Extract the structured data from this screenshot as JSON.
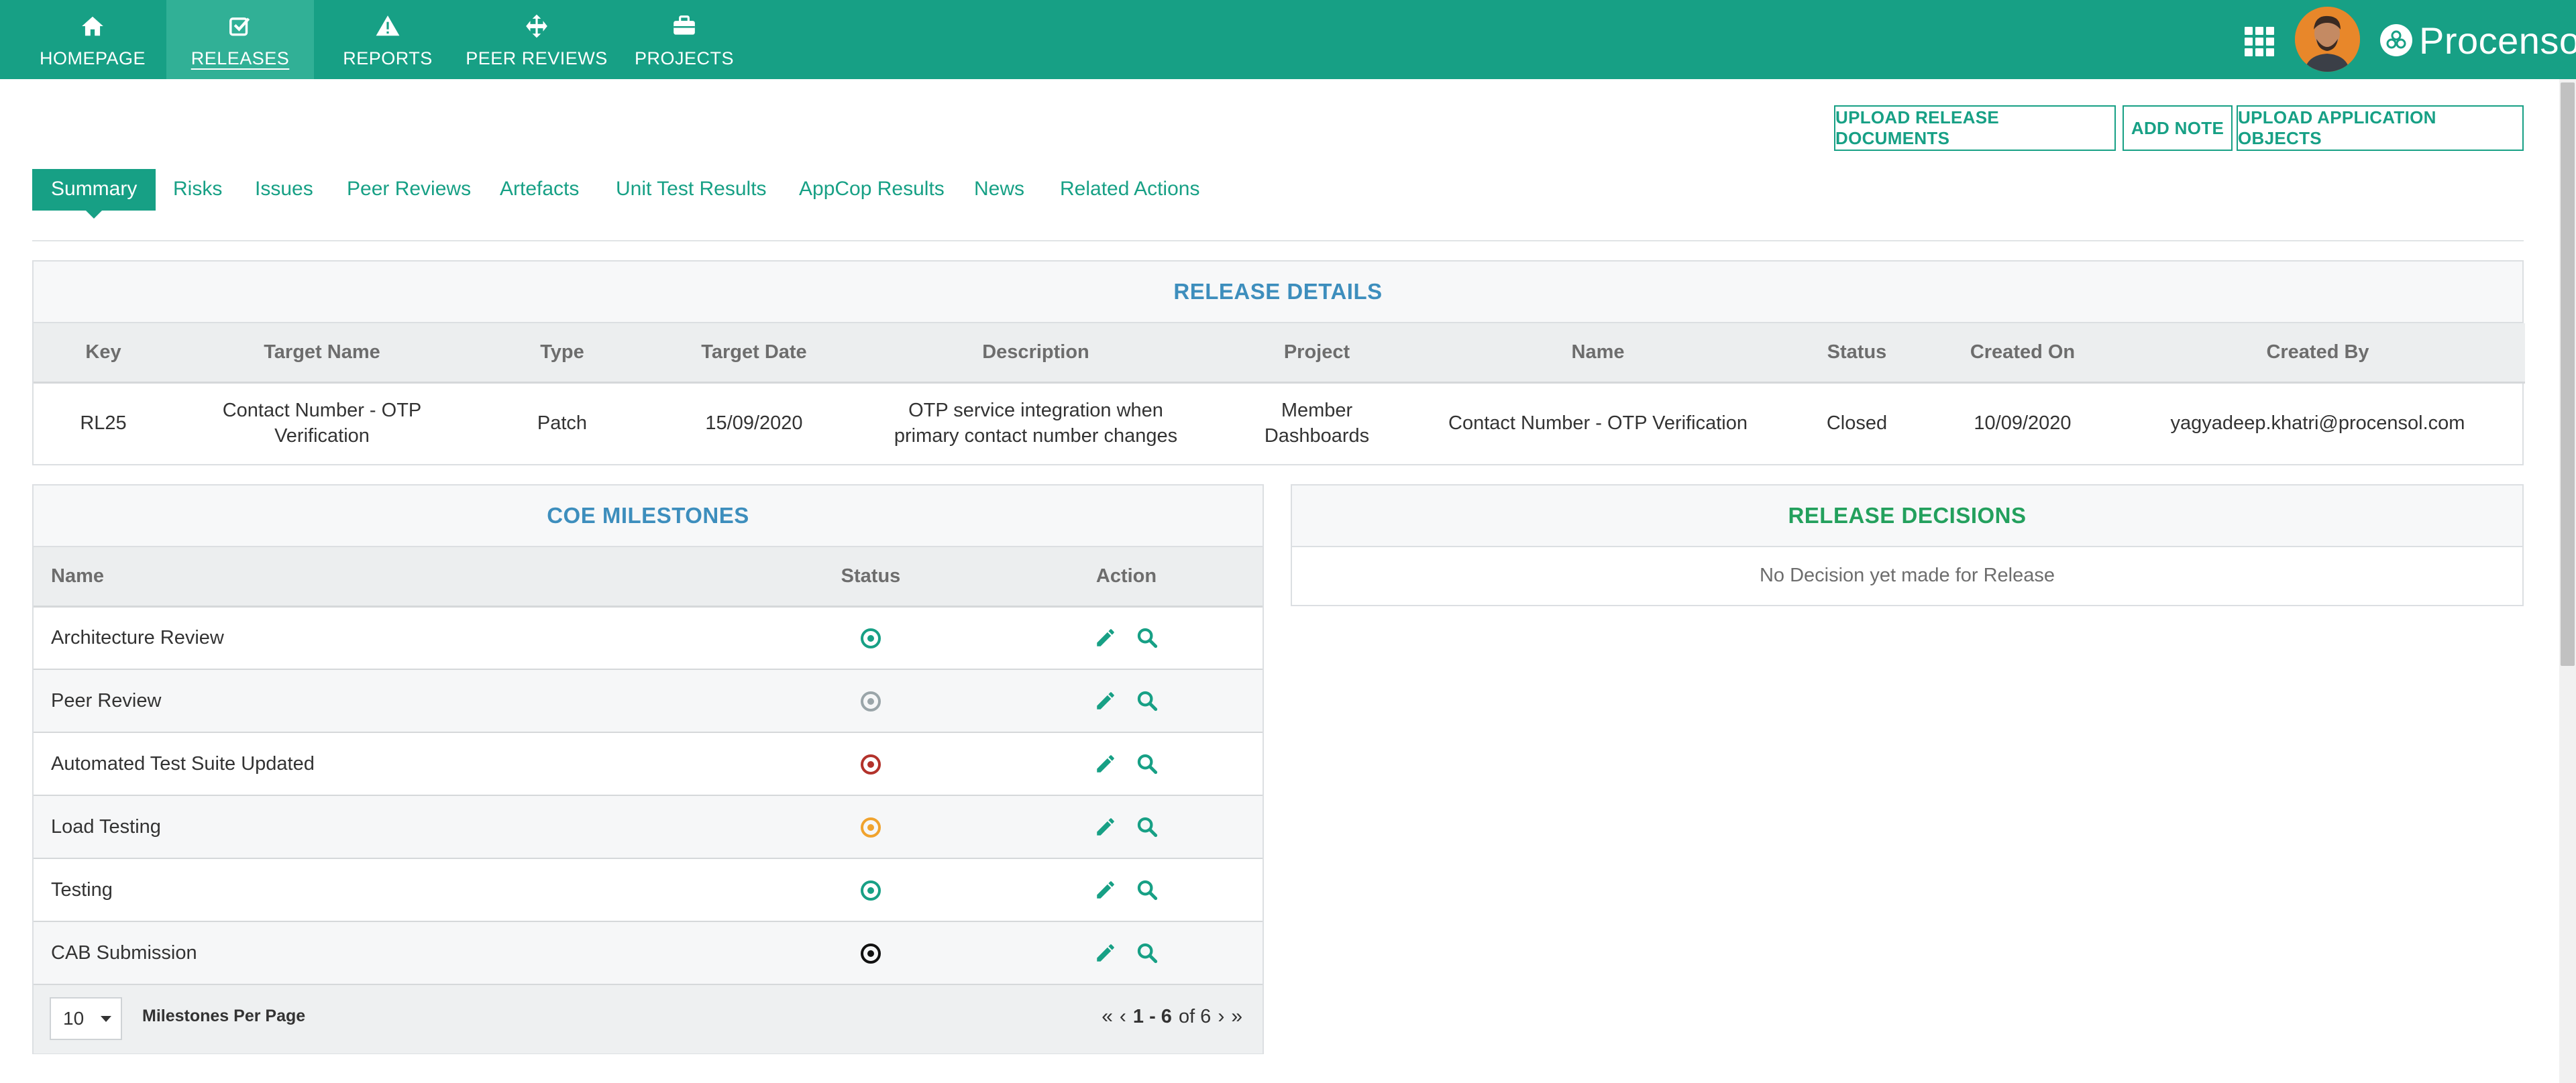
{
  "nav": {
    "items": [
      {
        "label": "HOMEPAGE",
        "icon": "home-icon"
      },
      {
        "label": "RELEASES",
        "icon": "check-square-icon"
      },
      {
        "label": "REPORTS",
        "icon": "warning-icon"
      },
      {
        "label": "PEER REVIEWS",
        "icon": "move-arrows-icon"
      },
      {
        "label": "PROJECTS",
        "icon": "briefcase-icon"
      }
    ],
    "active": "RELEASES",
    "brand": "Procensol"
  },
  "actions": {
    "upload_docs": "UPLOAD RELEASE DOCUMENTS",
    "add_note": "ADD NOTE",
    "upload_objects": "UPLOAD APPLICATION OBJECTS"
  },
  "tabs": [
    {
      "label": "Summary"
    },
    {
      "label": "Risks"
    },
    {
      "label": "Issues"
    },
    {
      "label": "Peer Reviews"
    },
    {
      "label": "Artefacts"
    },
    {
      "label": "Unit Test Results"
    },
    {
      "label": "AppCop Results"
    },
    {
      "label": "News"
    },
    {
      "label": "Related Actions"
    }
  ],
  "release_details": {
    "title": "RELEASE DETAILS",
    "headers": [
      "Key",
      "Target Name",
      "Type",
      "Target Date",
      "Description",
      "Project",
      "Name",
      "Status",
      "Created On",
      "Created By"
    ],
    "row": {
      "key": "RL25",
      "target_name": "Contact Number - OTP Verification",
      "type": "Patch",
      "target_date": "15/09/2020",
      "description_line1": "OTP service integration when",
      "description_line2": "primary contact number changes",
      "project_line1": "Member",
      "project_line2": "Dashboards",
      "name": "Contact Number - OTP Verification",
      "status": "Closed",
      "created_on": "10/09/2020",
      "created_by": "yagyadeep.khatri@procensol.com"
    }
  },
  "milestones": {
    "title": "COE MILESTONES",
    "headers": {
      "name": "Name",
      "status": "Status",
      "action": "Action"
    },
    "rows": [
      {
        "name": "Architecture Review",
        "status_color": "#17a085"
      },
      {
        "name": "Peer Review",
        "status_color": "#9aa5a9"
      },
      {
        "name": "Automated Test Suite Updated",
        "status_color": "#b3322b"
      },
      {
        "name": "Load Testing",
        "status_color": "#f0a32e"
      },
      {
        "name": "Testing",
        "status_color": "#17a085"
      },
      {
        "name": "CAB Submission",
        "status_color": "#111111"
      }
    ],
    "per_page_value": "10",
    "per_page_label": "Milestones Per Page",
    "pager": {
      "range": "1 - 6",
      "of_text": "of 6"
    }
  },
  "decisions": {
    "title": "RELEASE DECISIONS",
    "empty_text": "No Decision yet made for Release"
  },
  "colors": {
    "brand_green": "#17a085",
    "title_blue": "#3d8ebd",
    "decision_green": "#23a05d"
  }
}
